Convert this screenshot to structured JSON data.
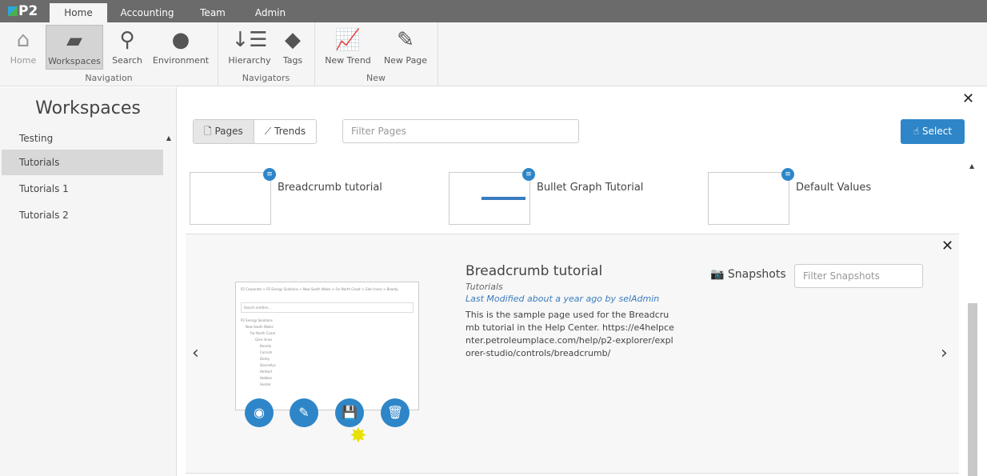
{
  "app": {
    "logo": "P2"
  },
  "tabs": [
    "Home",
    "Accounting",
    "Team",
    "Admin"
  ],
  "ribbon": {
    "buttons": [
      "Home",
      "Workspaces",
      "Search",
      "Environment",
      "Hierarchy",
      "Tags",
      "New Trend",
      "New Page"
    ],
    "groups": [
      "Navigation",
      "Navigators",
      "New"
    ]
  },
  "sidebar": {
    "title": "Workspaces",
    "items": [
      "Testing",
      "Tutorials",
      "Tutorials 1",
      "Tutorials 2"
    ]
  },
  "toolbar": {
    "pages": "Pages",
    "trends": "Trends",
    "filter_placeholder": "Filter Pages",
    "select": "Select"
  },
  "cards": [
    "Breadcrumb tutorial",
    "Bullet Graph Tutorial",
    "Default Values"
  ],
  "detail": {
    "title": "Breadcrumb tutorial",
    "workspace": "Tutorials",
    "modified": "Last Modified about a year ago by selAdmin",
    "description": "This is the sample page used for the Breadcrumb tutorial in the Help Center. https://e4helpcenter.petroleumplace.com/help/p2-explorer/explorer-studio/controls/breadcrumb/",
    "snapshots": "Snapshots",
    "snap_placeholder": "Filter Snapshots",
    "preview_breadcrumb": "P2 Corporate > P2 Energy Solutions > New South Wales > Far North Coast > Glen Innes > Beardy",
    "preview_search": "Search entities...",
    "preview_tree": [
      "P2 Energy Solutions",
      "New South Wales",
      "Far North Coast",
      "Glen Innes",
      "Beardy",
      "Cornish",
      "Derby",
      "Donnellys",
      "Herbert",
      "Hobbes",
      "Hunter"
    ]
  }
}
